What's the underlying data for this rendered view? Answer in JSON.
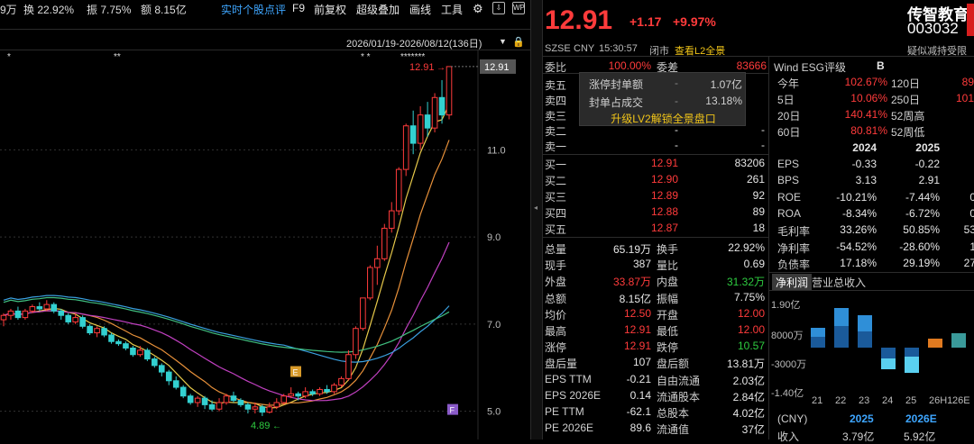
{
  "toolbar": {
    "partial_left": "9万",
    "turnover": "换 22.92%",
    "amplitude": "振 7.75%",
    "amount": "额 8.15亿",
    "items": [
      "实时个股点评",
      "F9",
      "前复权",
      "超级叠加",
      "画线",
      "工具"
    ],
    "date_range": "2026/01/19-2026/08/12(136日)"
  },
  "chart": {
    "current_price_label": "12.91",
    "high_label": "12.91",
    "low_label": "4.89",
    "y_ticks": [
      "11.0",
      "9.0",
      "7.0",
      "5.0"
    ],
    "marker_e": "E",
    "marker_f": "F",
    "stars_left": "*",
    "stars_mid": "**",
    "stars_right": "* *",
    "stars_top": "*******"
  },
  "chart_data": {
    "type": "candlestick",
    "y_ticks": [
      11.0,
      9.0,
      7.0,
      5.0
    ],
    "ylim": [
      4.6,
      12.95
    ],
    "candles": [
      [
        7.1,
        7.2,
        7.25,
        6.95
      ],
      [
        7.2,
        7.3,
        7.35,
        7.1
      ],
      [
        7.3,
        7.15,
        7.4,
        7.1
      ],
      [
        7.15,
        7.3,
        7.35,
        7.1
      ],
      [
        7.3,
        7.4,
        7.45,
        7.25
      ],
      [
        7.4,
        7.35,
        7.5,
        7.3
      ],
      [
        7.35,
        7.45,
        7.55,
        7.3
      ],
      [
        7.45,
        7.3,
        7.5,
        7.25
      ],
      [
        7.3,
        7.2,
        7.35,
        7.1
      ],
      [
        7.2,
        7.05,
        7.25,
        7.0
      ],
      [
        7.05,
        7.15,
        7.25,
        7.0
      ],
      [
        7.15,
        6.95,
        7.2,
        6.9
      ],
      [
        6.95,
        6.8,
        7.0,
        6.75
      ],
      [
        6.8,
        6.9,
        6.95,
        6.7
      ],
      [
        6.9,
        6.75,
        6.95,
        6.7
      ],
      [
        6.75,
        6.6,
        6.8,
        6.55
      ],
      [
        6.6,
        6.55,
        6.65,
        6.5
      ],
      [
        6.55,
        6.45,
        6.6,
        6.4
      ],
      [
        6.45,
        6.3,
        6.5,
        6.25
      ],
      [
        6.3,
        6.4,
        6.5,
        6.25
      ],
      [
        6.4,
        6.2,
        6.45,
        6.15
      ],
      [
        6.2,
        6.05,
        6.25,
        6.0
      ],
      [
        6.05,
        5.9,
        6.1,
        5.8
      ],
      [
        5.9,
        5.7,
        5.95,
        5.6
      ],
      [
        5.7,
        5.55,
        5.8,
        5.5
      ],
      [
        5.55,
        5.35,
        5.6,
        5.3
      ],
      [
        5.35,
        5.2,
        5.4,
        5.15
      ],
      [
        5.2,
        5.3,
        5.35,
        5.1
      ],
      [
        5.3,
        5.15,
        5.35,
        5.05
      ],
      [
        5.15,
        5.05,
        5.25,
        5.0
      ],
      [
        5.05,
        5.2,
        5.3,
        5.0
      ],
      [
        5.2,
        5.35,
        5.4,
        5.15
      ],
      [
        5.35,
        5.25,
        5.45,
        5.2
      ],
      [
        5.25,
        5.15,
        5.3,
        5.1
      ],
      [
        5.15,
        5.05,
        5.2,
        4.95
      ],
      [
        5.05,
        5.1,
        5.2,
        4.95
      ],
      [
        5.1,
        4.98,
        5.15,
        4.89
      ],
      [
        4.98,
        5.1,
        5.2,
        4.95
      ],
      [
        5.1,
        5.2,
        5.3,
        5.05
      ],
      [
        5.2,
        5.35,
        5.4,
        5.15
      ],
      [
        5.35,
        5.4,
        5.55,
        5.3
      ],
      [
        5.4,
        5.35,
        5.45,
        5.25
      ],
      [
        5.35,
        5.45,
        5.55,
        5.3
      ],
      [
        5.45,
        5.4,
        5.5,
        5.35
      ],
      [
        5.4,
        5.5,
        5.55,
        5.35
      ],
      [
        5.5,
        5.45,
        5.6,
        5.4
      ],
      [
        5.45,
        5.6,
        5.65,
        5.4
      ],
      [
        5.6,
        5.75,
        5.8,
        5.55
      ],
      [
        5.75,
        6.3,
        6.4,
        5.7
      ],
      [
        6.3,
        6.9,
        6.95,
        6.2
      ],
      [
        6.9,
        7.6,
        7.6,
        6.85
      ],
      [
        7.6,
        8.3,
        8.35,
        7.55
      ],
      [
        8.3,
        8.5,
        8.8,
        7.9
      ],
      [
        8.5,
        9.2,
        9.3,
        8.45
      ],
      [
        9.2,
        9.6,
        9.8,
        9.1
      ],
      [
        9.6,
        10.55,
        10.6,
        9.5
      ],
      [
        10.55,
        11.55,
        11.6,
        10.4
      ],
      [
        11.55,
        11.15,
        11.9,
        10.9
      ],
      [
        11.15,
        11.8,
        12.0,
        11.0
      ],
      [
        11.8,
        11.5,
        12.1,
        11.3
      ],
      [
        11.5,
        12.2,
        12.3,
        11.4
      ],
      [
        12.2,
        11.8,
        12.6,
        11.6
      ],
      [
        11.8,
        12.91,
        12.91,
        11.7
      ]
    ],
    "series": [
      {
        "name": "MA5",
        "color": "#e6c84a"
      },
      {
        "name": "MA10",
        "color": "#e8913a"
      },
      {
        "name": "MA20",
        "color": "#c040c0"
      },
      {
        "name": "MA60",
        "color": "#3aa0e0"
      },
      {
        "name": "MA120",
        "color": "#40c080"
      }
    ]
  },
  "quote": {
    "price": "12.91",
    "change": "+1.17",
    "change_pct": "+9.97%",
    "name": "传智教育",
    "code": "003032",
    "exchange": "SZSE",
    "currency": "CNY",
    "time": "15:30:57",
    "status": "闭市",
    "l2_link": "查看L2全景",
    "hint": "疑似减持受限",
    "weibi_label": "委比",
    "weibi_value": "100.00%",
    "weicha_label": "委差",
    "weicha_value": "83666"
  },
  "orderbook": {
    "sells": [
      {
        "label": "卖五",
        "price": "",
        "vol": ""
      },
      {
        "label": "卖四",
        "price": "",
        "vol": ""
      },
      {
        "label": "卖三",
        "price": "",
        "vol": ""
      },
      {
        "label": "卖二",
        "price": "-",
        "vol": "-"
      },
      {
        "label": "卖一",
        "price": "-",
        "vol": "-"
      }
    ],
    "buys": [
      {
        "label": "买一",
        "price": "12.91",
        "vol": "83206"
      },
      {
        "label": "买二",
        "price": "12.90",
        "vol": "261"
      },
      {
        "label": "买三",
        "price": "12.89",
        "vol": "92"
      },
      {
        "label": "买四",
        "price": "12.88",
        "vol": "89"
      },
      {
        "label": "买五",
        "price": "12.87",
        "vol": "18"
      }
    ]
  },
  "popup": {
    "rows": [
      {
        "label": "涨停封单额",
        "dash": "-",
        "value": "1.07亿"
      },
      {
        "label": "封单占成交",
        "dash": "-",
        "value": "13.18%"
      }
    ],
    "upgrade": "升级LV2解锁全景盘口"
  },
  "stats": [
    {
      "l1": "总量",
      "v1": "65.19万",
      "c1": "wht",
      "l2": "换手",
      "v2": "22.92%",
      "c2": "wht"
    },
    {
      "l1": "现手",
      "v1": "387",
      "c1": "wht",
      "l2": "量比",
      "v2": "0.69",
      "c2": "wht"
    },
    {
      "l1": "外盘",
      "v1": "33.87万",
      "c1": "red",
      "l2": "内盘",
      "v2": "31.32万",
      "c2": "green"
    },
    {
      "l1": "总额",
      "v1": "8.15亿",
      "c1": "wht",
      "l2": "振幅",
      "v2": "7.75%",
      "c2": "wht"
    },
    {
      "l1": "均价",
      "v1": "12.50",
      "c1": "red",
      "l2": "开盘",
      "v2": "12.00",
      "c2": "red"
    },
    {
      "l1": "最高",
      "v1": "12.91",
      "c1": "red",
      "l2": "最低",
      "v2": "12.00",
      "c2": "red"
    },
    {
      "l1": "涨停",
      "v1": "12.91",
      "c1": "red",
      "l2": "跌停",
      "v2": "10.57",
      "c2": "green"
    },
    {
      "l1": "盘后量",
      "v1": "107",
      "c1": "wht",
      "l2": "盘后额",
      "v2": "13.81万",
      "c2": "wht"
    },
    {
      "l1": "EPS TTM",
      "v1": "-0.21",
      "c1": "wht",
      "l2": "自由流通",
      "v2": "2.03亿",
      "c2": "wht"
    },
    {
      "l1": "EPS 2026E",
      "v1": "0.14",
      "c1": "wht",
      "l2": "流通股本",
      "v2": "2.84亿",
      "c2": "wht"
    },
    {
      "l1": "PE TTM",
      "v1": "-62.1",
      "c1": "wht",
      "l2": "总股本",
      "v2": "4.02亿",
      "c2": "wht"
    },
    {
      "l1": "PE 2026E",
      "v1": "89.6",
      "c1": "wht",
      "l2": "流通值",
      "v2": "37亿",
      "c2": "wht"
    }
  ],
  "esg": {
    "label": "Wind ESG评级",
    "value": "B"
  },
  "periods": [
    {
      "l1": "今年",
      "v1": "102.67%",
      "l2": "120日",
      "v2": "89"
    },
    {
      "l1": "5日",
      "v1": "10.06%",
      "l2": "250日",
      "v2": "101"
    },
    {
      "l1": "20日",
      "v1": "140.41%",
      "l2": "52周高",
      "v2": ""
    },
    {
      "l1": "60日",
      "v1": "80.81%",
      "l2": "52周低",
      "v2": ""
    }
  ],
  "fin": {
    "years": [
      "2024",
      "2025",
      "20"
    ],
    "rows": [
      {
        "label": "EPS",
        "a": "-0.33",
        "b": "-0.22",
        "c": ""
      },
      {
        "label": "BPS",
        "a": "3.13",
        "b": "2.91",
        "c": ""
      },
      {
        "label": "ROE",
        "a": "-10.21%",
        "b": "-7.44%",
        "c": "0"
      },
      {
        "label": "ROA",
        "a": "-8.34%",
        "b": "-6.72%",
        "c": "0"
      },
      {
        "label": "毛利率",
        "a": "33.26%",
        "b": "50.85%",
        "c": "53"
      },
      {
        "label": "净利率",
        "a": "-54.52%",
        "b": "-28.60%",
        "c": "1"
      },
      {
        "label": "负债率",
        "a": "17.18%",
        "b": "29.19%",
        "c": "27"
      }
    ]
  },
  "mini": {
    "tab_active": "净利润",
    "tab_other": "营业总收入",
    "y_labels": [
      "1.90亿",
      "8000万",
      "-3000万",
      "-1.40亿"
    ],
    "x_labels": [
      "21",
      "22",
      "23",
      "24",
      "25",
      "26H1",
      "26E"
    ],
    "footer_label": "(CNY)",
    "footer_y1": "2025",
    "footer_y2": "2026E",
    "bottom_label": "收入",
    "bottom_v1": "3.79亿",
    "bottom_v2": "5.92亿"
  }
}
